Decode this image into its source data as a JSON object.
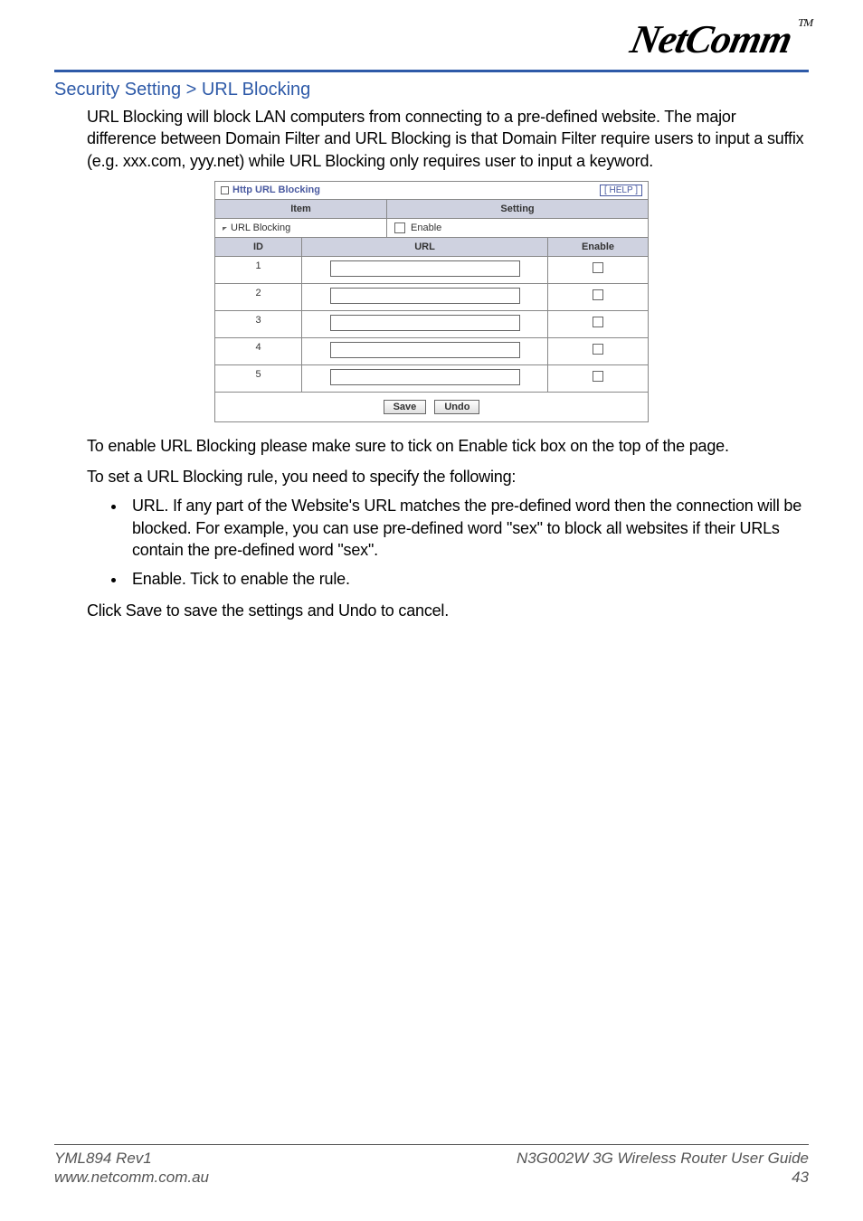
{
  "logo": {
    "text": "NetComm",
    "tm": "TM"
  },
  "breadcrumb": "Security Setting > URL Blocking",
  "intro": "URL Blocking will block LAN computers from connecting to a pre-defined website. The major difference between Domain Filter and URL Blocking is that Domain Filter require users to input a suffix (e.g. xxx.com, yyy.net) while URL Blocking only requires user to input a keyword.",
  "screenshot": {
    "panel_title": "Http URL Blocking",
    "help_label": "[ HELP ]",
    "header1": {
      "item": "Item",
      "setting": "Setting"
    },
    "url_blocking_label": "URL Blocking",
    "enable_checkbox_label": "Enable",
    "header2": {
      "id": "ID",
      "url": "URL",
      "enable": "Enable"
    },
    "rows": [
      {
        "id": "1",
        "url": "",
        "enable": false
      },
      {
        "id": "2",
        "url": "",
        "enable": false
      },
      {
        "id": "3",
        "url": "",
        "enable": false
      },
      {
        "id": "4",
        "url": "",
        "enable": false
      },
      {
        "id": "5",
        "url": "",
        "enable": false
      }
    ],
    "save_btn": "Save",
    "undo_btn": "Undo"
  },
  "para_enable": "To enable URL Blocking please make sure to tick on Enable tick box on the top of the page.",
  "para_set": "To set a URL Blocking rule, you need to specify the following:",
  "bullets": [
    "URL. If any part of the Website's URL matches the pre-defined word then the connection will be blocked. For example, you can use pre-defined word \"sex\" to block all websites if their URLs contain the pre-defined word \"sex\".",
    "Enable. Tick to enable the rule."
  ],
  "para_save": "Click Save to save the settings and Undo to cancel.",
  "footer": {
    "left_line1": "YML894 Rev1",
    "left_line2": "www.netcomm.com.au",
    "right_line1": "N3G002W 3G Wireless Router User Guide",
    "right_line2": "43"
  }
}
